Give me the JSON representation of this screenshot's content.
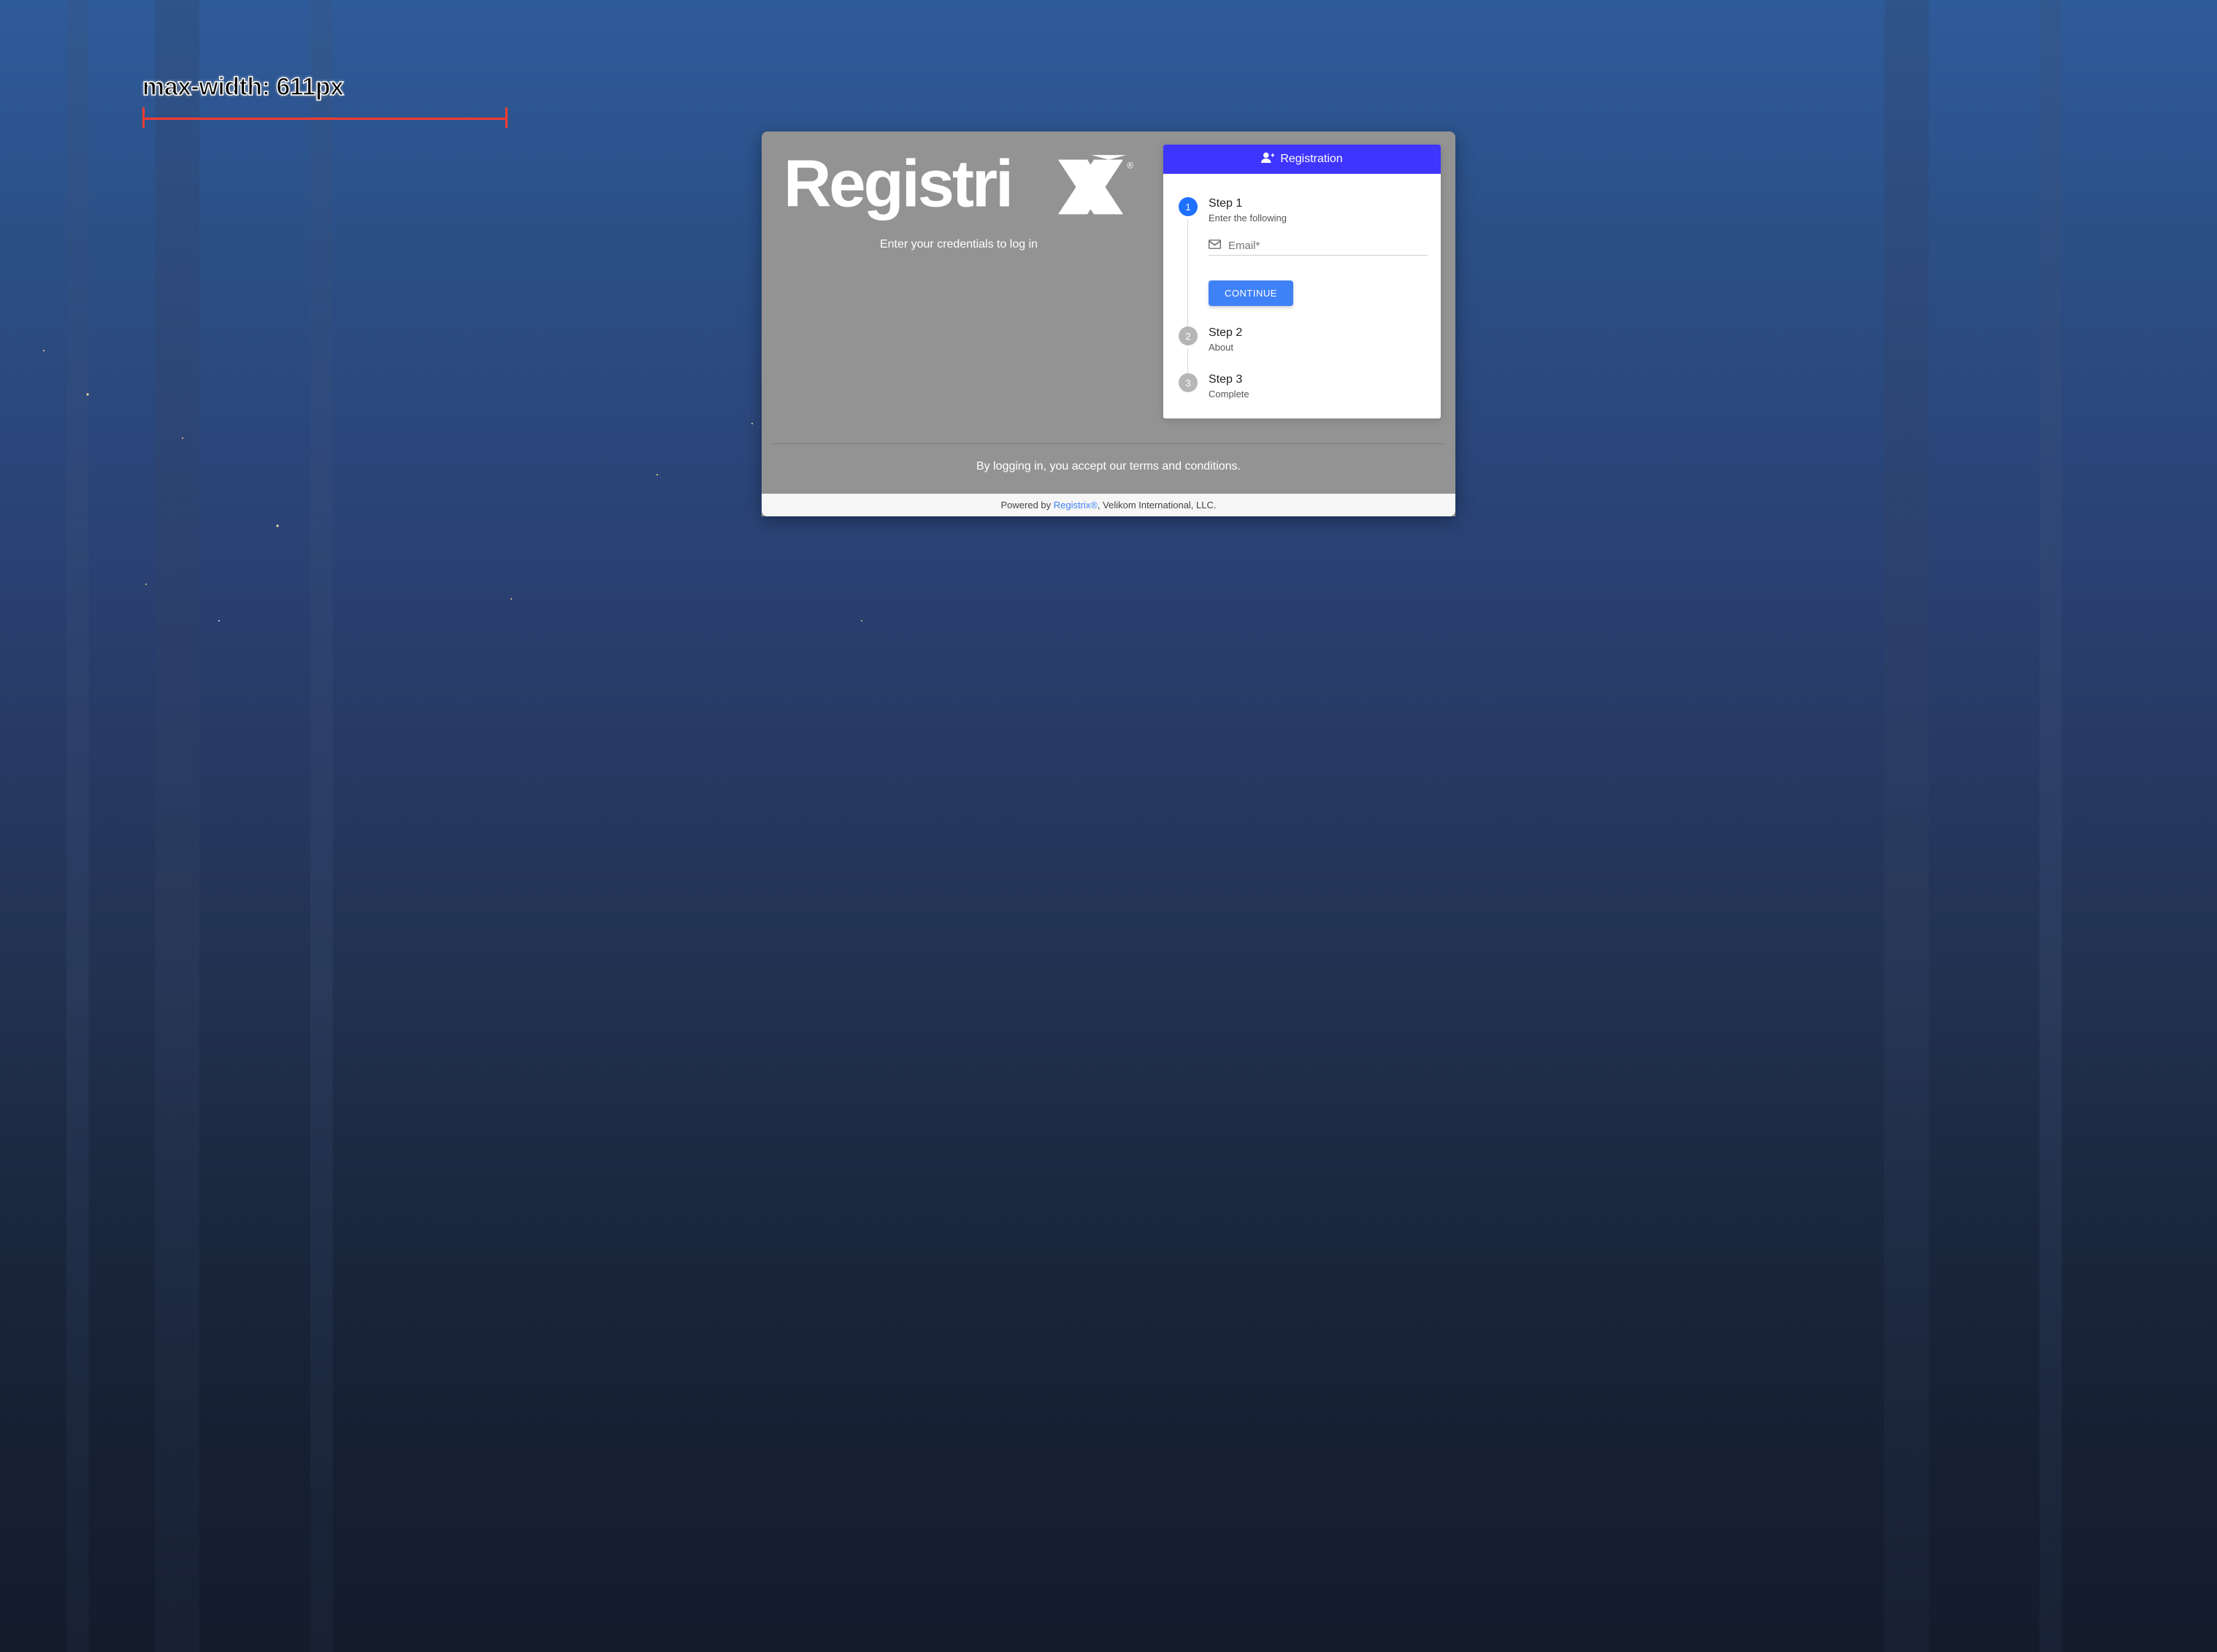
{
  "annotation": {
    "label": "max-width: 611px"
  },
  "left": {
    "logo_alt": "RegistriX",
    "credentials_text": "Enter your credentials to log in"
  },
  "panel": {
    "header_label": "Registration"
  },
  "steps": {
    "0": {
      "num": "1",
      "title": "Step 1",
      "sub": "Enter the following"
    },
    "1": {
      "num": "2",
      "title": "Step 2",
      "sub": "About"
    },
    "2": {
      "num": "3",
      "title": "Step 3",
      "sub": "Complete"
    }
  },
  "form": {
    "email_placeholder": "Email*",
    "continue_label": "CONTINUE"
  },
  "footer": {
    "tos_text": "By logging  in, you accept our terms and conditions.",
    "powered_prefix": "Powered by ",
    "powered_link": "Registrix®",
    "powered_suffix": ", Velikom International, LLC."
  }
}
